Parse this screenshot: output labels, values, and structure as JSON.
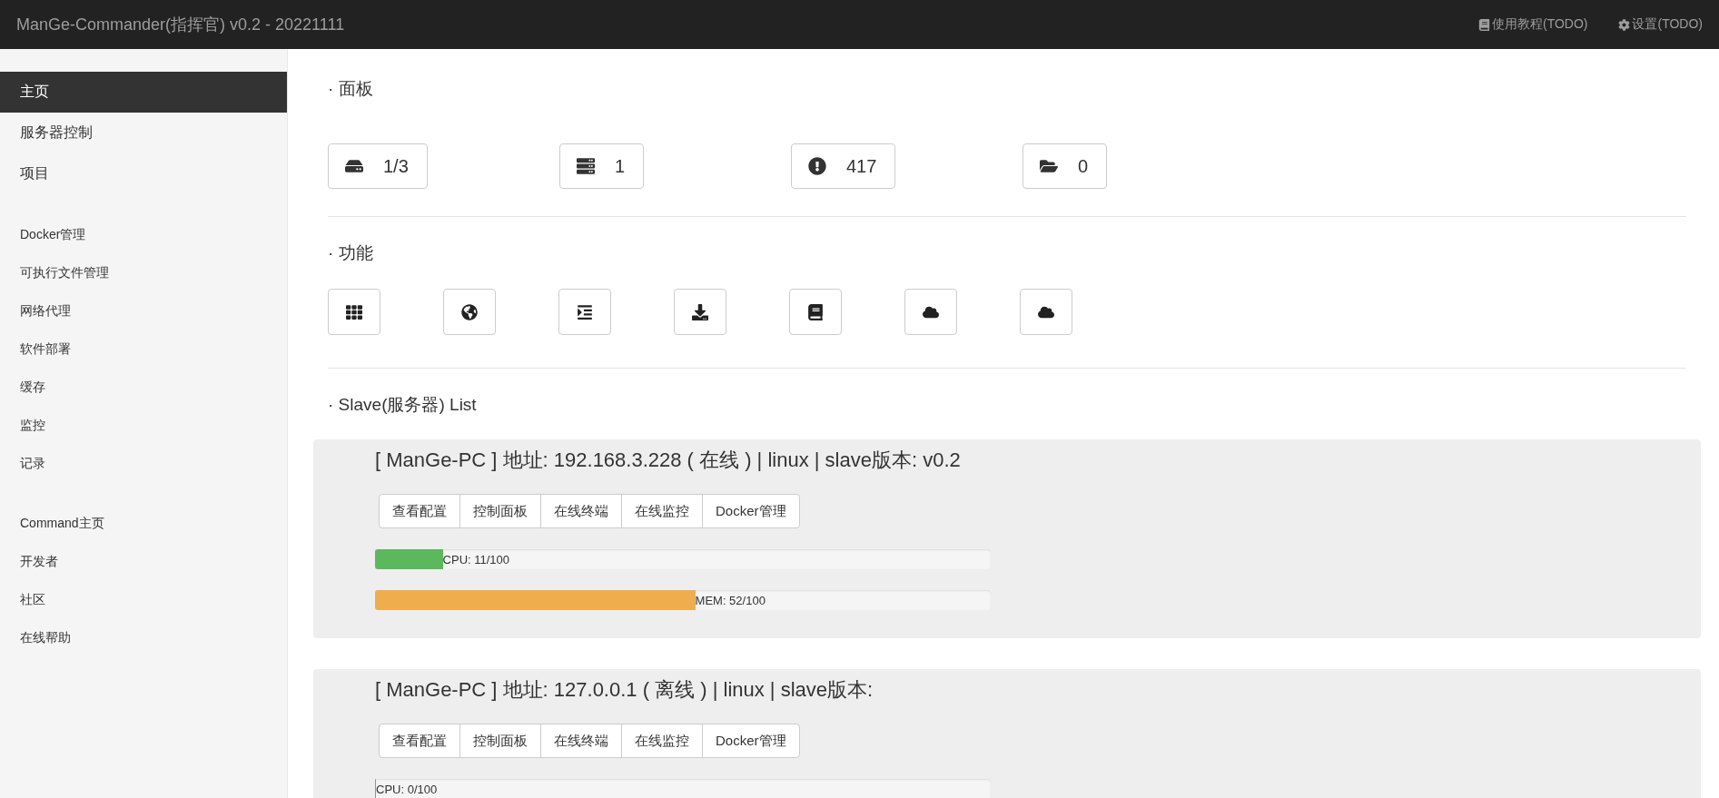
{
  "header": {
    "title": "ManGe-Commander(指挥官) v0.2 - 20221111",
    "links": [
      {
        "kind": "book",
        "label": "使用教程(TODO)"
      },
      {
        "kind": "gear",
        "label": "设置(TODO)"
      }
    ]
  },
  "sidebar": {
    "groups": [
      {
        "items": [
          {
            "label": "主页",
            "selected": true
          },
          {
            "label": "服务器控制",
            "selected": false
          },
          {
            "label": "项目",
            "selected": false
          }
        ]
      },
      {
        "items": [
          {
            "label": "Docker管理",
            "selected": false
          },
          {
            "label": "可执行文件管理",
            "selected": false
          },
          {
            "label": "网络代理",
            "selected": false
          },
          {
            "label": "软件部署",
            "selected": false
          },
          {
            "label": "缓存",
            "selected": false
          },
          {
            "label": "监控",
            "selected": false
          },
          {
            "label": "记录",
            "selected": false
          }
        ]
      },
      {
        "items": [
          {
            "label": "Command主页",
            "selected": false
          },
          {
            "label": "开发者",
            "selected": false
          },
          {
            "label": "社区",
            "selected": false
          },
          {
            "label": "在线帮助",
            "selected": false
          }
        ]
      }
    ]
  },
  "panel": {
    "heading": "· 面板",
    "stats": [
      {
        "kind": "drive",
        "value": "1/3"
      },
      {
        "kind": "server",
        "value": "1"
      },
      {
        "kind": "alert",
        "value": "417"
      },
      {
        "kind": "folder",
        "value": "0"
      }
    ]
  },
  "functions": {
    "heading": "· 功能",
    "buttons": [
      {
        "kind": "grid"
      },
      {
        "kind": "globe"
      },
      {
        "kind": "indent"
      },
      {
        "kind": "download"
      },
      {
        "kind": "book"
      },
      {
        "kind": "cloud"
      },
      {
        "kind": "cloud"
      }
    ]
  },
  "slaves": {
    "heading": "· Slave(服务器) List",
    "items": [
      {
        "title": "[ ManGe-PC ] 地址: 192.168.3.228 ( 在线 ) | linux | slave版本: v0.2",
        "buttons": [
          "查看配置",
          "控制面板",
          "在线终端",
          "在线监控",
          "Docker管理"
        ],
        "bars": [
          {
            "kind": "cpu",
            "label": "CPU: 11/100",
            "level": 0.11
          },
          {
            "kind": "mem",
            "label": "MEM: 52/100",
            "level": 0.52
          }
        ]
      },
      {
        "title": "[ ManGe-PC ] 地址: 127.0.0.1 ( 离线 ) | linux | slave版本:",
        "buttons": [
          "查看配置",
          "控制面板",
          "在线终端",
          "在线监控",
          "Docker管理"
        ],
        "bars": [
          {
            "kind": "cpu",
            "label": "CPU: 0/100",
            "level": 0
          }
        ]
      }
    ]
  }
}
